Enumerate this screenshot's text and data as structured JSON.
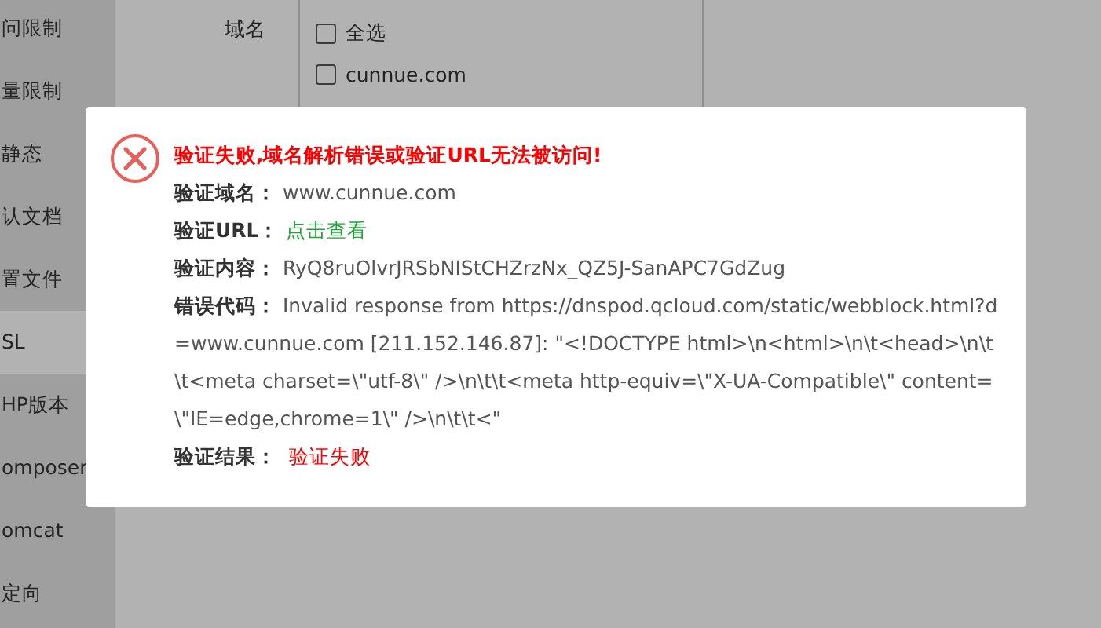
{
  "sidebar": {
    "items": [
      {
        "label": "问限制",
        "selected": false
      },
      {
        "label": "量限制",
        "selected": false
      },
      {
        "label": "静态",
        "selected": false
      },
      {
        "label": "认文档",
        "selected": false
      },
      {
        "label": "置文件",
        "selected": false
      },
      {
        "label": "SL",
        "selected": true
      },
      {
        "label": "HP版本",
        "selected": false
      },
      {
        "label": "omposer",
        "selected": false
      },
      {
        "label": "omcat",
        "selected": false
      },
      {
        "label": "定向",
        "selected": false
      }
    ]
  },
  "form": {
    "label": "域名",
    "options": [
      {
        "label": "全选",
        "checked": false
      },
      {
        "label": "cunnue.com",
        "checked": false
      }
    ]
  },
  "dialog": {
    "title": "验证失败,域名解析错误或验证URL无法被访问!",
    "fields": [
      {
        "label": "验证域名：",
        "value": "www.cunnue.com",
        "kind": "text"
      },
      {
        "label": "验证URL：",
        "value": "点击查看",
        "kind": "link"
      },
      {
        "label": "验证内容：",
        "value": "RyQ8ruOlvrJRSbNIStCHZrzNx_QZ5J-SanAPC7GdZug",
        "kind": "text"
      },
      {
        "label": "错误代码：",
        "value": "Invalid response from https://dnspod.qcloud.com/static/webblock.html?d=www.cunnue.com [211.152.146.87]: \"<!DOCTYPE html>\\n<html>\\n\\t<head>\\n\\t\\t<meta charset=\\\"utf-8\\\" />\\n\\t\\t<meta http-equiv=\\\"X-UA-Compatible\\\" content=\\\"IE=edge,chrome=1\\\" />\\n\\t\\t<\"",
        "kind": "text"
      },
      {
        "label": "验证结果：",
        "value": "验证失败",
        "kind": "error"
      }
    ]
  }
}
